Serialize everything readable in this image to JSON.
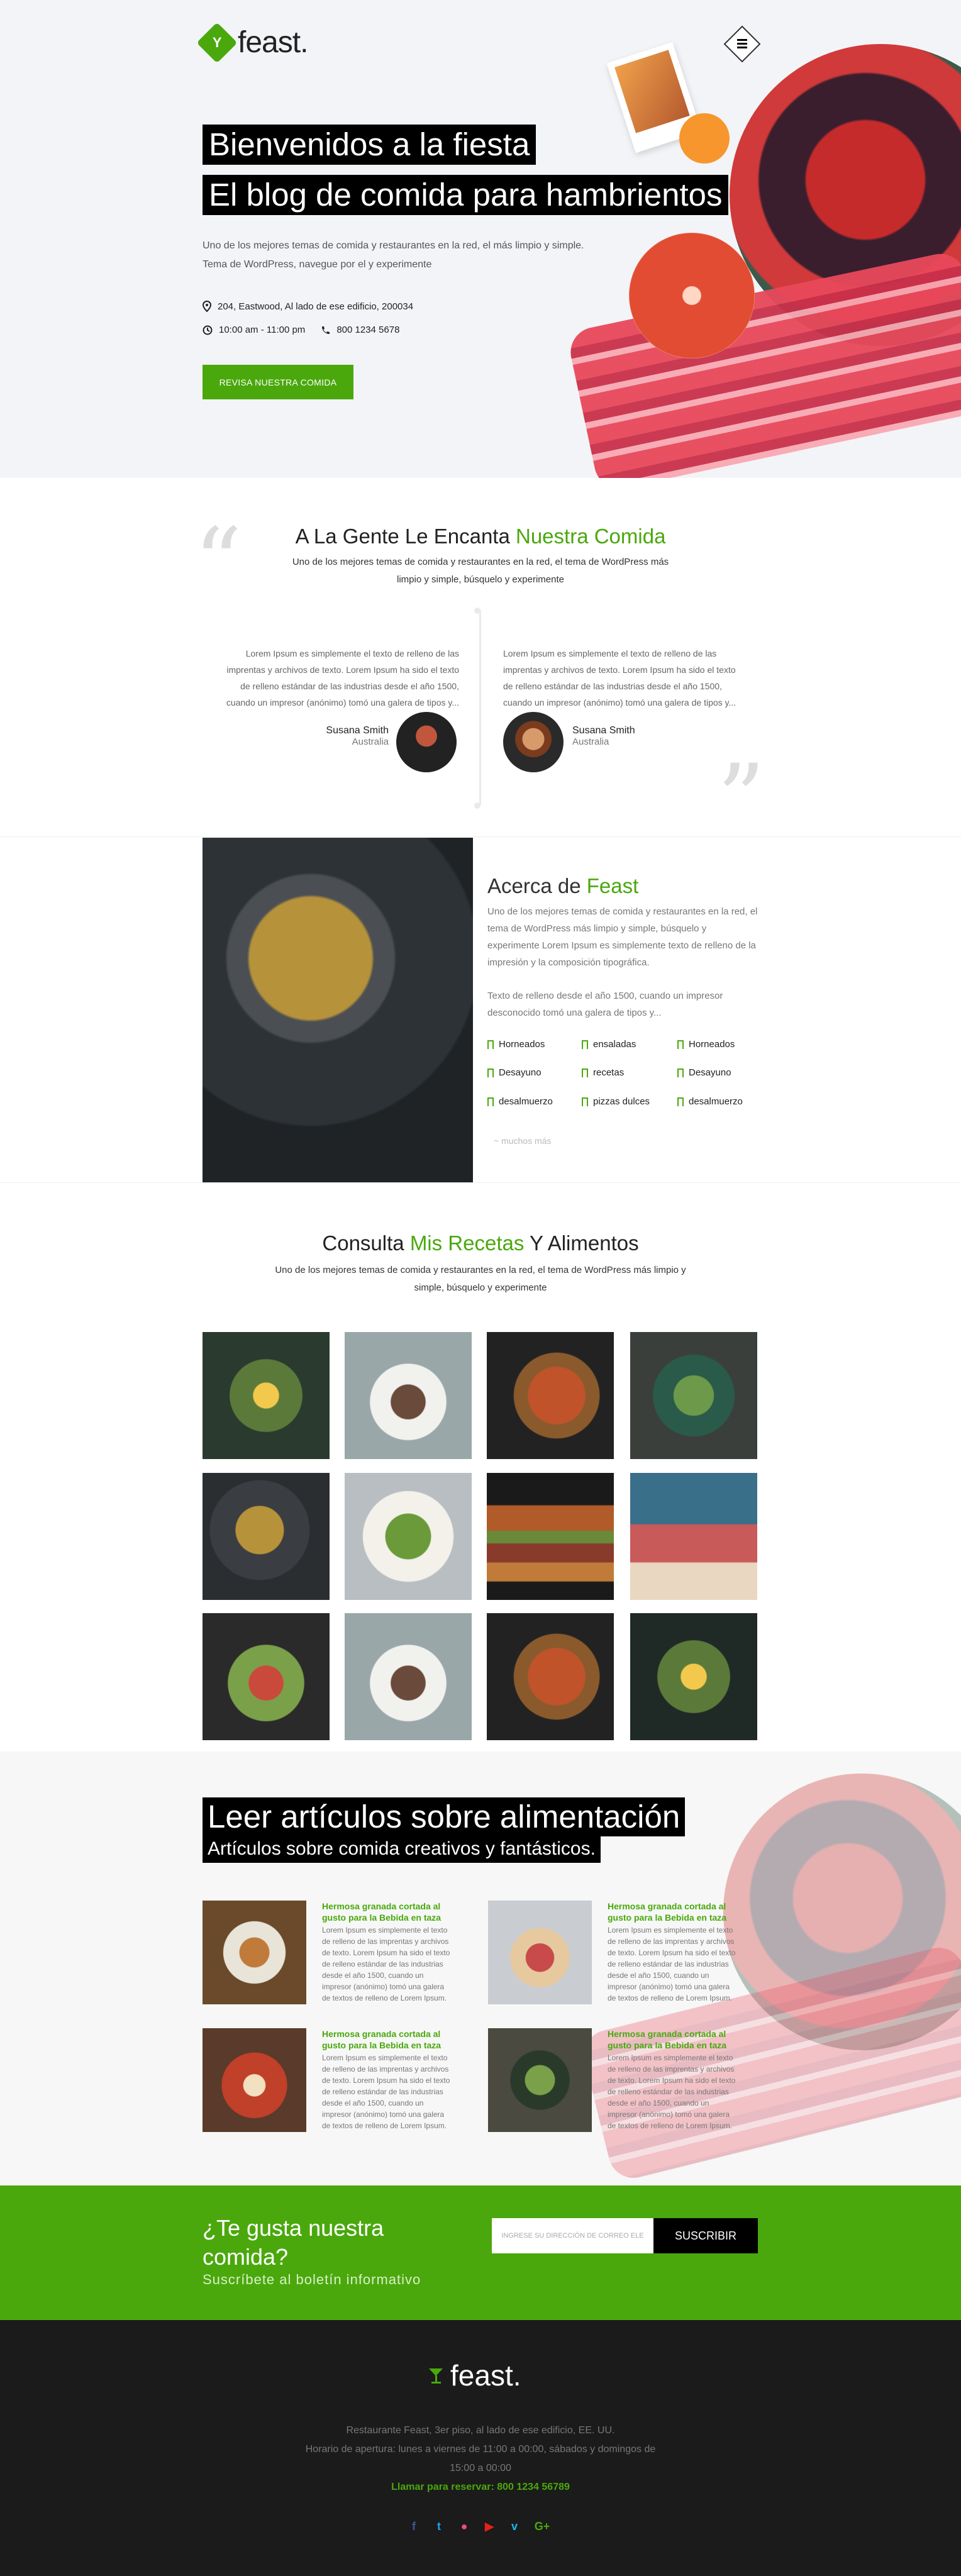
{
  "header": {
    "logo_text": "feast.",
    "logo_letter": "Y",
    "title_line1": "Bienvenidos a la fiesta",
    "title_line2": "El blog de comida para hambrientos",
    "description": "Uno de los mejores temas de comida y restaurantes en la red, el más limpio y simple. Tema de WordPress, navegue por el y experimente",
    "address": "204, Eastwood, Al lado de ese edificio, 200034",
    "hours": "10:00 am - 11:00 pm",
    "phone": "800 1234 5678",
    "cta_label": "REVISA NUESTRA COMIDA"
  },
  "testimonials": {
    "title_a": "A La Gente Le Encanta",
    "title_b": "Nuestra Comida",
    "subtitle": "Uno de los mejores temas de comida y restaurantes en la red, el tema de WordPress más limpio y simple, búsquelo y experimente",
    "items": [
      {
        "text": "Lorem Ipsum es simplemente el texto de relleno de las imprentas y archivos de texto. Lorem Ipsum ha sido el texto de relleno estándar de las industrias desde el año 1500, cuando un impresor (anónimo) tomó una galera de tipos y...",
        "name": "Susana Smith",
        "location": "Australia"
      },
      {
        "text": "Lorem Ipsum es simplemente el texto de relleno de las imprentas y archivos de texto. Lorem Ipsum ha sido el texto de relleno estándar de las industrias desde el año 1500, cuando un impresor (anónimo) tomó una galera de tipos y...",
        "name": "Susana Smith",
        "location": "Australia"
      }
    ]
  },
  "about": {
    "title_a": "Acerca de",
    "title_b": "Feast",
    "p1": "Uno de los mejores temas de comida y restaurantes en la red, el tema de WordPress más limpio y simple, búsquelo y experimente Lorem Ipsum es simplemente texto de relleno de la impresión y la composición tipográfica.",
    "p2": "Texto de relleno desde el año 1500, cuando un impresor desconocido tomó una galera de tipos y...",
    "tags": [
      "Horneados",
      "ensaladas",
      "Horneados",
      "Desayuno",
      "recetas",
      "Desayuno",
      "desalmuerzo",
      "pizzas dulces",
      "desalmuerzo"
    ],
    "more": "~ muchos más"
  },
  "recipes": {
    "title_a": "Consulta",
    "title_b": "Mis Recetas",
    "title_c": "Y Alimentos",
    "subtitle": "Uno de los mejores temas de comida y restaurantes en la red, el tema de WordPress más limpio y simple, búsquelo y experimente"
  },
  "articles": {
    "title": "Leer artículos sobre alimentación",
    "subtitle": "Artículos sobre comida creativos y fantásticos.",
    "items": [
      {
        "title": "Hermosa granada cortada al gusto para la Bebida en taza",
        "body": "Lorem Ipsum es simplemente el texto de relleno de las imprentas y archivos de texto. Lorem Ipsum ha sido el texto de relleno estándar de las industrias desde el año 1500, cuando un impresor (anónimo) tomó una galera de textos de relleno de Lorem Ipsum."
      },
      {
        "title": "Hermosa granada cortada al gusto para la Bebida en taza",
        "body": "Lorem Ipsum es simplemente el texto de relleno de las imprentas y archivos de texto. Lorem Ipsum ha sido el texto de relleno estándar de las industrias desde el año 1500, cuando un impresor (anónimo) tomó una galera de textos de relleno de Lorem Ipsum."
      },
      {
        "title": "Hermosa granada cortada al gusto para la Bebida en taza",
        "body": "Lorem Ipsum es simplemente el texto de relleno de las imprentas y archivos de texto. Lorem Ipsum ha sido el texto de relleno estándar de las industrias desde el año 1500, cuando un impresor (anónimo) tomó una galera de textos de relleno de Lorem Ipsum."
      },
      {
        "title": "Hermosa granada cortada al gusto para la Bebida en taza",
        "body": "Lorem Ipsum es simplemente el texto de relleno de las imprentas y archivos de texto. Lorem Ipsum ha sido el texto de relleno estándar de las industrias desde el año 1500, cuando un impresor (anónimo) tomó una galera de textos de relleno de Lorem Ipsum."
      }
    ]
  },
  "newsletter": {
    "title": "¿Te gusta nuestra comida?",
    "subtitle": "Suscríbete al boletín informativo",
    "placeholder": "INGRESE SU DIRECCIÓN DE CORREO ELE",
    "button": "SUSCRIBIR"
  },
  "footer": {
    "logo_text": "feast.",
    "address": "Restaurante Feast, 3er piso, al lado de ese edificio, EE. UU.",
    "hours": "Horario de apertura: lunes a viernes de 11:00 a 00:00, sábados y domingos de 15:00 a 00:00",
    "reserve": "Llamar para reservar: 800 1234 56789",
    "social": [
      {
        "icon": "facebook-icon",
        "glyph": "f",
        "color": "#3b5998"
      },
      {
        "icon": "twitter-icon",
        "glyph": "t",
        "color": "#1da1f2"
      },
      {
        "icon": "dribbble-icon",
        "glyph": "●",
        "color": "#ea4c89"
      },
      {
        "icon": "youtube-icon",
        "glyph": "▶",
        "color": "#e62117"
      },
      {
        "icon": "vimeo-icon",
        "glyph": "v",
        "color": "#1ab7ea"
      },
      {
        "icon": "google-plus-icon",
        "glyph": "G+",
        "color": "#4aa80d"
      }
    ]
  },
  "colors": {
    "accent": "#4aa80d",
    "dark": "#000000",
    "footer_bg": "#1b1b1b"
  }
}
